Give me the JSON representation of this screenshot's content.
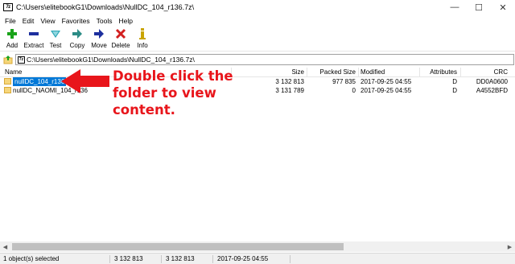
{
  "window": {
    "title": "C:\\Users\\elitebookG1\\Downloads\\NullDC_104_r136.7z\\",
    "app_icon_text": "7z",
    "controls": {
      "minimize": "—",
      "maximize": "☐",
      "close": "✕"
    }
  },
  "menu": [
    "File",
    "Edit",
    "View",
    "Favorites",
    "Tools",
    "Help"
  ],
  "toolbar": [
    {
      "label": "Add",
      "icon": "add-icon",
      "color": "#1aa31a"
    },
    {
      "label": "Extract",
      "icon": "extract-icon",
      "color": "#1d2f9e"
    },
    {
      "label": "Test",
      "icon": "test-icon",
      "color": "#2aa5b4"
    },
    {
      "label": "Copy",
      "icon": "copy-icon",
      "color": "#2c8c86"
    },
    {
      "label": "Move",
      "icon": "move-icon",
      "color": "#1d2f9e"
    },
    {
      "label": "Delete",
      "icon": "delete-icon",
      "color": "#d21f1f"
    },
    {
      "label": "Info",
      "icon": "info-icon",
      "color": "#c9a400"
    }
  ],
  "address": {
    "path": "C:\\Users\\elitebookG1\\Downloads\\NullDC_104_r136.7z\\"
  },
  "columns": [
    "Name",
    "Size",
    "Packed Size",
    "Modified",
    "Attributes",
    "CRC"
  ],
  "rows": [
    {
      "name": "nullDC_104_r136",
      "size": "3 132 813",
      "packed": "977 835",
      "modified": "2017-09-25 04:55",
      "attributes": "D",
      "crc": "DD0A0600",
      "selected": true
    },
    {
      "name": "nullDC_NAOMI_104_r136",
      "size": "3 131 789",
      "packed": "0",
      "modified": "2017-09-25 04:55",
      "attributes": "D",
      "crc": "A4552BFD",
      "selected": false
    }
  ],
  "annotation": {
    "line1": "Double click the",
    "line2": "folder to view",
    "line3": "content.",
    "color": "#e8151b"
  },
  "status": {
    "selection": "1 object(s) selected",
    "size": "3 132 813",
    "packed": "3 132 813",
    "modified": "2017-09-25 04:55"
  },
  "accent": "#0078d7"
}
